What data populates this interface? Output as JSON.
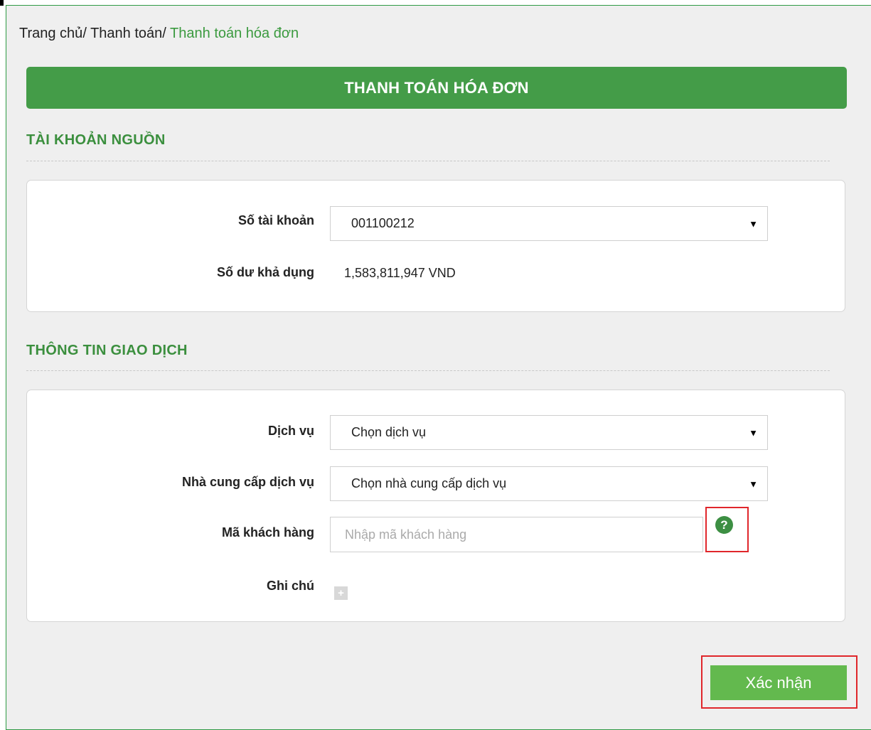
{
  "breadcrumb": {
    "home": "Trang chủ",
    "sep1": "/",
    "payment": "Thanh toán",
    "sep2": "/",
    "current": "Thanh toán hóa đơn"
  },
  "header": {
    "title": "THANH TOÁN HÓA ĐƠN"
  },
  "source_account": {
    "section_title": "TÀI KHOẢN NGUỒN",
    "account_label": "Số tài khoản",
    "account_value": "001100212",
    "balance_label": "Số dư khả dụng",
    "balance_value": "1,583,811,947 VND"
  },
  "transaction": {
    "section_title": "THÔNG TIN GIAO DỊCH",
    "service_label": "Dịch vụ",
    "service_value": "Chọn dịch vụ",
    "provider_label": "Nhà cung cấp dịch vụ",
    "provider_value": "Chọn nhà cung cấp dịch vụ",
    "customer_code_label": "Mã khách hàng",
    "customer_code_placeholder": "Nhập mã khách hàng",
    "note_label": "Ghi chú",
    "help_glyph": "?",
    "plus_glyph": "+"
  },
  "actions": {
    "confirm_label": "Xác nhận"
  },
  "colors": {
    "primary_green": "#449c48",
    "section_green": "#3b8f3e",
    "button_green": "#63b94e",
    "highlight_red": "#e0262b"
  },
  "icons": {
    "dropdown": "caret-down-icon",
    "help": "question-circle-icon",
    "note": "plus-square-icon"
  }
}
